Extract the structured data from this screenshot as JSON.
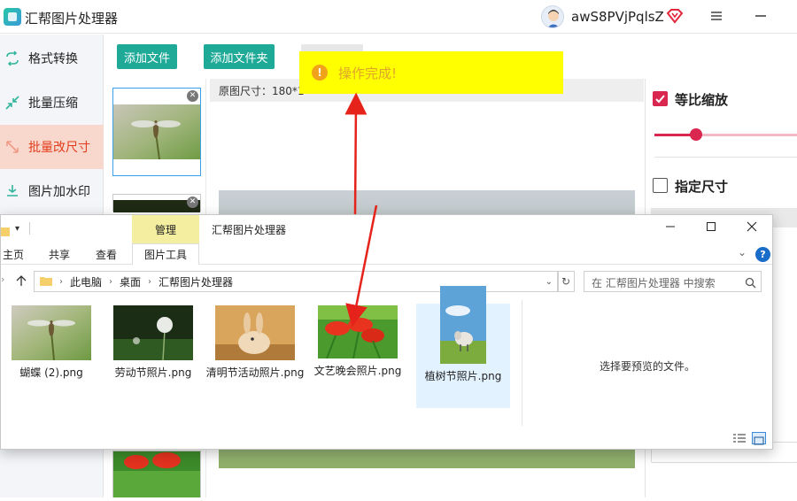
{
  "app": {
    "title": "汇帮图片处理器",
    "username": "awS8PVjPqlsZ",
    "icons": {
      "logo": "app-logo-icon",
      "vip": "diamond-icon",
      "menu": "hamburger-menu-icon",
      "minimize": "minimize-icon"
    }
  },
  "sidebar": {
    "items": [
      {
        "label": "格式转换",
        "icon": "format-convert-icon",
        "active": false
      },
      {
        "label": "批量压缩",
        "icon": "compress-icon",
        "active": false
      },
      {
        "label": "批量改尺寸",
        "icon": "resize-icon",
        "active": true
      },
      {
        "label": "图片加水印",
        "icon": "watermark-icon",
        "active": false
      }
    ]
  },
  "toolbar": {
    "add_file": "添加文件",
    "add_folder": "添加文件夹"
  },
  "infobar": {
    "original_size_label": "原图尺寸：180*1"
  },
  "toast": {
    "text": "操作完成!",
    "icon": "info-icon",
    "color": "#ffff00"
  },
  "right_panel": {
    "keep_ratio_label": "等比缩放",
    "keep_ratio_checked": true,
    "fixed_size_label": "指定尺寸",
    "fixed_size_checked": false,
    "slider_level": 0.29,
    "accent": "#d9274f"
  },
  "explorer": {
    "title": "汇帮图片处理器",
    "manage_tab": "管理",
    "ribbon_tabs": [
      "主页",
      "共享",
      "查看"
    ],
    "tools_tab": "图片工具",
    "breadcrumb": [
      "此电脑",
      "桌面",
      "汇帮图片处理器"
    ],
    "search_placeholder": "在 汇帮图片处理器 中搜索",
    "preview_text": "选择要预览的文件。",
    "files": [
      {
        "name": "蝴蝶 (2).png",
        "thumb": "dragonfly"
      },
      {
        "name": "劳动节照片.png",
        "thumb": "dandelion"
      },
      {
        "name": "清明节活动照片.png",
        "thumb": "rabbit"
      },
      {
        "name": "文艺晚会照片.png",
        "thumb": "red-flowers"
      },
      {
        "name": "植树节照片.png",
        "thumb": "sheep"
      }
    ],
    "selected_file_index": 4
  }
}
